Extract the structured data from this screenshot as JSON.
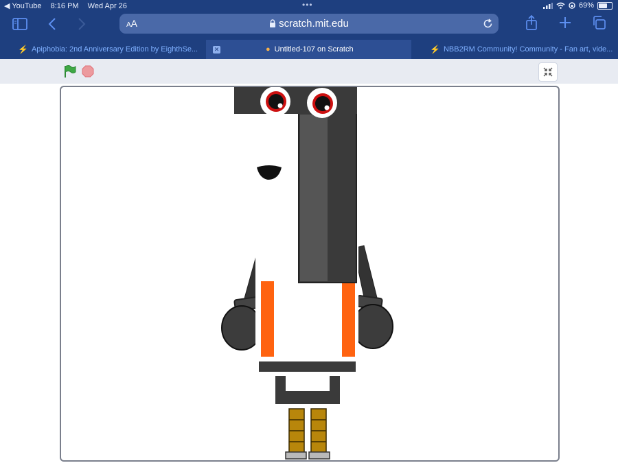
{
  "status": {
    "back_app": "◀ YouTube",
    "time": "8:16 PM",
    "date": "Wed Apr 26",
    "battery": "69%",
    "battery_level": 0.69
  },
  "toolbar": {
    "sidebar_icon": "sidebar-icon",
    "back_icon": "chevron-left-icon",
    "forward_icon": "chevron-right-icon",
    "share_icon": "share-icon",
    "new_tab_icon": "plus-icon",
    "tabs_icon": "tabs-overview-icon"
  },
  "address": {
    "aa_small": "A",
    "aa_large": "A",
    "url": "scratch.mit.edu"
  },
  "tabs": [
    {
      "title": "Apiphobia: 2nd Anniversary Edition by EighthSe...",
      "active": false
    },
    {
      "title": "Untitled-107 on Scratch",
      "active": true
    },
    {
      "title": "NBB2RM Community! Community - Fan art, vide...",
      "active": false
    }
  ],
  "player": {
    "green_flag_icon": "green-flag-icon",
    "stop_icon": "stop-icon",
    "fullscreen_icon": "exit-fullscreen-icon"
  },
  "colors": {
    "chrome_blue": "#1e3f7f",
    "url_field": "#4a69a8",
    "link_blue": "#7fb0ff",
    "sprite_dark": "#3a3a3a",
    "sprite_orange": "#ff6310",
    "sprite_leg": "#b8860b",
    "eye_red": "#cc1010"
  }
}
